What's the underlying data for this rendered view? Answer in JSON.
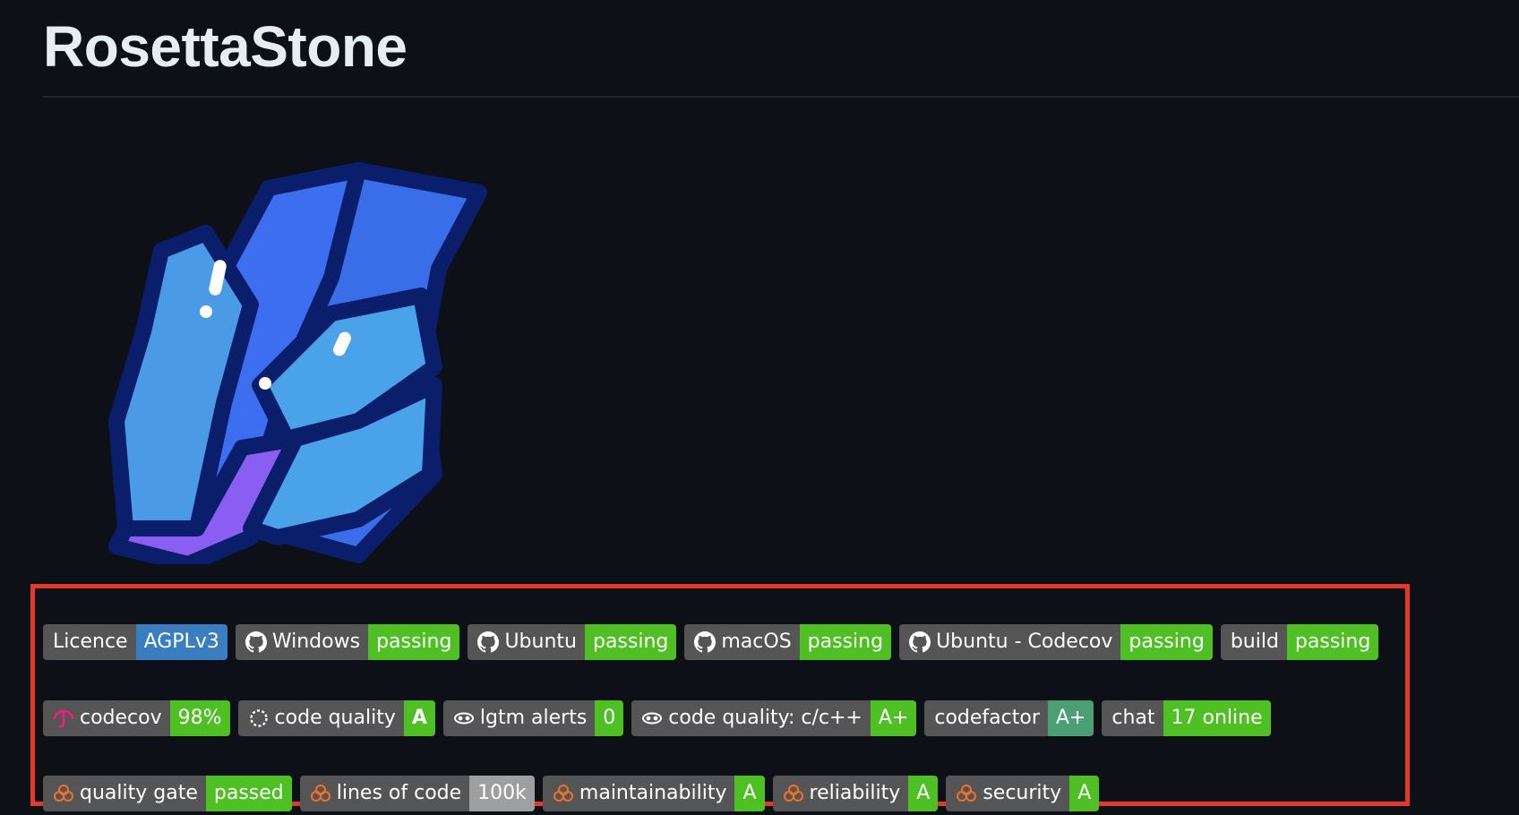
{
  "repo": {
    "title": "RosettaStone"
  },
  "badges": {
    "row1": [
      {
        "label": "Licence",
        "value": "AGPLv3",
        "icon": "none",
        "color": "#3a7ebf"
      },
      {
        "label": "Windows",
        "value": "passing",
        "icon": "github-icon",
        "color": "#4fc023"
      },
      {
        "label": "Ubuntu",
        "value": "passing",
        "icon": "github-icon",
        "color": "#4fc023"
      },
      {
        "label": "macOS",
        "value": "passing",
        "icon": "github-icon",
        "color": "#4fc023"
      },
      {
        "label": "Ubuntu - Codecov",
        "value": "passing",
        "icon": "github-icon",
        "color": "#4fc023"
      },
      {
        "label": "build",
        "value": "passing",
        "icon": "none",
        "color": "#4fc023"
      }
    ],
    "row2": [
      {
        "label": "codecov",
        "value": "98%",
        "icon": "codecov-umbrella-icon",
        "color": "#4fc023"
      },
      {
        "label": "code quality",
        "value": "A",
        "icon": "codacy-icon",
        "color": "#4fc023"
      },
      {
        "label": "lgtm alerts",
        "value": "0",
        "icon": "lgtm-icon",
        "color": "#4fc023"
      },
      {
        "label": "code quality: c/c++",
        "value": "A+",
        "icon": "lgtm-icon",
        "color": "#4fc023"
      },
      {
        "label": "codefactor",
        "value": "A+",
        "icon": "none",
        "color": "#4c9f74"
      },
      {
        "label": "chat",
        "value": "17 online",
        "icon": "none",
        "color": "#4fc023"
      }
    ],
    "row3": [
      {
        "label": "quality gate",
        "value": "passed",
        "icon": "sonarcloud-icon",
        "color": "#4fc023"
      },
      {
        "label": "lines of code",
        "value": "100k",
        "icon": "sonarcloud-icon",
        "color": "#9f9f9f"
      },
      {
        "label": "maintainability",
        "value": "A",
        "icon": "sonarcloud-icon",
        "color": "#4fc023"
      },
      {
        "label": "reliability",
        "value": "A",
        "icon": "sonarcloud-icon",
        "color": "#4fc023"
      },
      {
        "label": "security",
        "value": "A",
        "icon": "sonarcloud-icon",
        "color": "#4fc023"
      }
    ]
  },
  "colors": {
    "background": "#0d1117",
    "highlight": "#e53a2b"
  }
}
